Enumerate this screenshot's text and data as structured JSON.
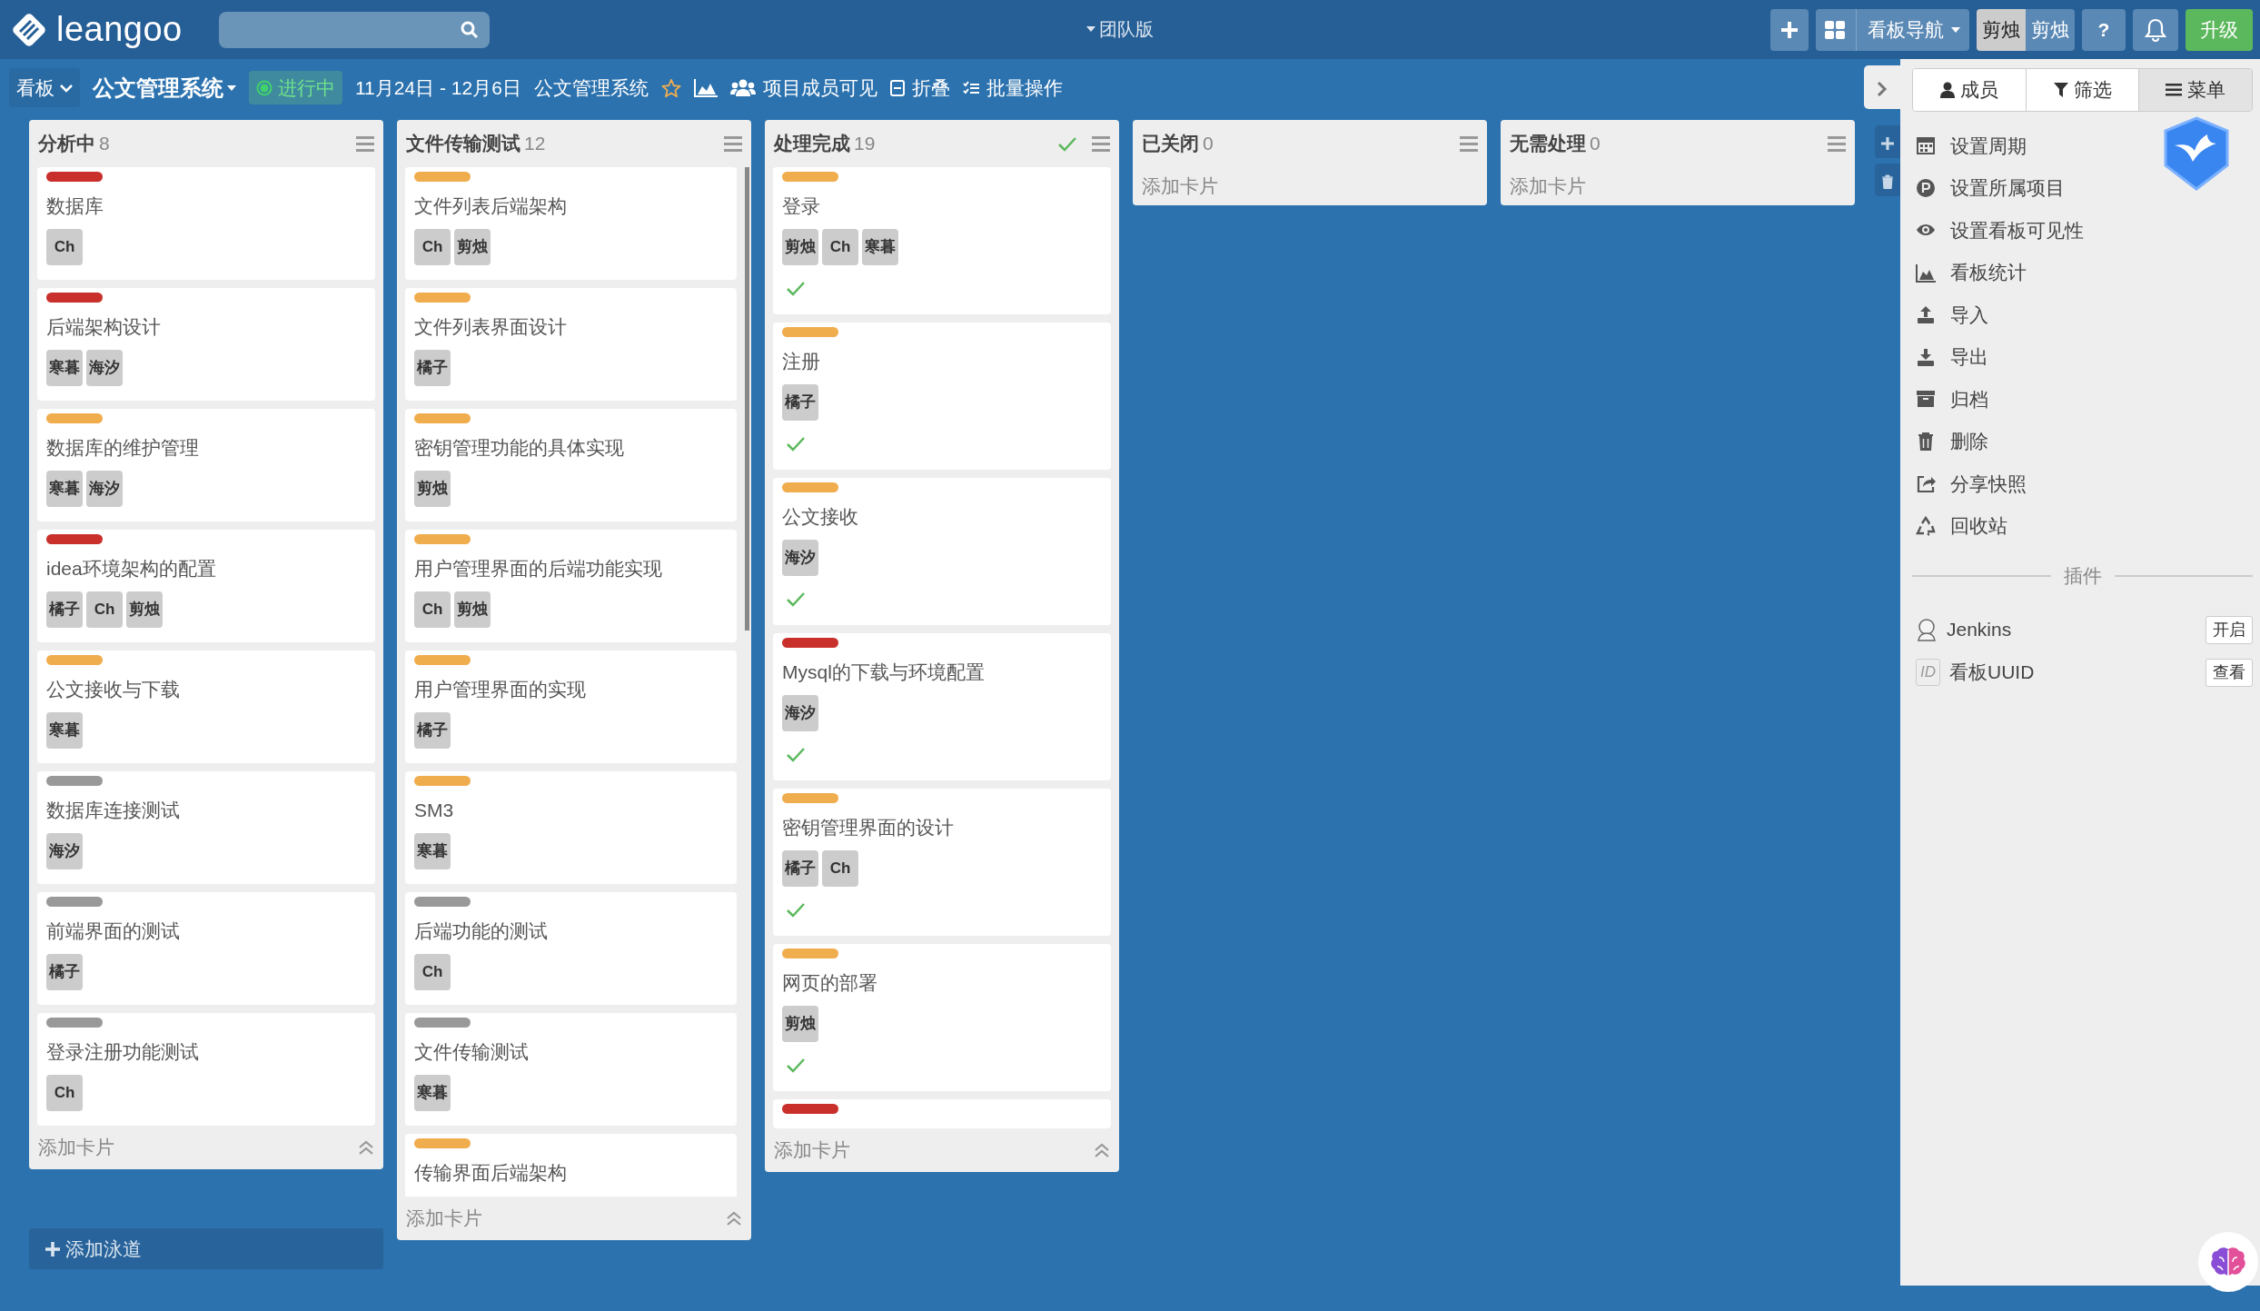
{
  "topbar": {
    "logo": "leangoo",
    "edition": "团队版",
    "nav": "看板导航",
    "user": {
      "avatar": "剪烛",
      "name": "剪烛"
    },
    "help": "?",
    "upgrade": "升级"
  },
  "board_bar": {
    "view": "看板",
    "title": "公文管理系统",
    "status": "进行中",
    "dates": "11月24日 - 12月6日",
    "project": "公文管理系统",
    "starred": false,
    "visibility": "项目成员可见",
    "collapse": "折叠",
    "batch": "批量操作"
  },
  "lists": [
    {
      "title": "分析中",
      "count": "8",
      "done": false,
      "add_card": "添加卡片",
      "cards": [
        {
          "color": "#c9302c",
          "title": "数据库",
          "members": [
            "Ch"
          ],
          "done": false
        },
        {
          "color": "#c9302c",
          "title": "后端架构设计",
          "members": [
            "寒暮",
            "海汐"
          ],
          "done": false
        },
        {
          "color": "#f0ad4e",
          "title": "数据库的维护管理",
          "members": [
            "寒暮",
            "海汐"
          ],
          "done": false
        },
        {
          "color": "#c9302c",
          "title": "idea环境架构的配置",
          "members": [
            "橘子",
            "Ch",
            "剪烛"
          ],
          "done": false
        },
        {
          "color": "#f0ad4e",
          "title": "公文接收与下载",
          "members": [
            "寒暮"
          ],
          "done": false
        },
        {
          "color": "#999999",
          "title": "数据库连接测试",
          "members": [
            "海汐"
          ],
          "done": false
        },
        {
          "color": "#999999",
          "title": "前端界面的测试",
          "members": [
            "橘子"
          ],
          "done": false
        },
        {
          "color": "#999999",
          "title": "登录注册功能测试",
          "members": [
            "Ch"
          ],
          "done": false
        }
      ]
    },
    {
      "title": "文件传输测试",
      "count": "12",
      "done": false,
      "add_card": "添加卡片",
      "cards": [
        {
          "color": "#f0ad4e",
          "title": "文件列表后端架构",
          "members": [
            "Ch",
            "剪烛"
          ],
          "done": false
        },
        {
          "color": "#f0ad4e",
          "title": "文件列表界面设计",
          "members": [
            "橘子"
          ],
          "done": false
        },
        {
          "color": "#f0ad4e",
          "title": "密钥管理功能的具体实现",
          "members": [
            "剪烛"
          ],
          "done": false
        },
        {
          "color": "#f0ad4e",
          "title": "用户管理界面的后端功能实现",
          "members": [
            "Ch",
            "剪烛"
          ],
          "done": false
        },
        {
          "color": "#f0ad4e",
          "title": "用户管理界面的实现",
          "members": [
            "橘子"
          ],
          "done": false
        },
        {
          "color": "#f0ad4e",
          "title": "SM3",
          "members": [
            "寒暮"
          ],
          "done": false
        },
        {
          "color": "#999999",
          "title": "后端功能的测试",
          "members": [
            "Ch"
          ],
          "done": false
        },
        {
          "color": "#999999",
          "title": "文件传输测试",
          "members": [
            "寒暮"
          ],
          "done": false
        },
        {
          "color": "#f0ad4e",
          "title": "传输界面后端架构",
          "done": false
        }
      ]
    },
    {
      "title": "处理完成",
      "count": "19",
      "done": true,
      "add_card": "添加卡片",
      "cards": [
        {
          "color": "#f0ad4e",
          "title": "登录",
          "members": [
            "剪烛",
            "Ch",
            "寒暮"
          ],
          "done": true
        },
        {
          "color": "#f0ad4e",
          "title": "注册",
          "members": [
            "橘子"
          ],
          "done": true
        },
        {
          "color": "#f0ad4e",
          "title": "公文接收",
          "members": [
            "海汐"
          ],
          "done": true
        },
        {
          "color": "#c9302c",
          "title": "Mysql的下载与环境配置",
          "members": [
            "海汐"
          ],
          "done": true
        },
        {
          "color": "#f0ad4e",
          "title": "密钥管理界面的设计",
          "members": [
            "橘子",
            "Ch"
          ],
          "done": true
        },
        {
          "color": "#f0ad4e",
          "title": "网页的部署",
          "members": [
            "剪烛"
          ],
          "done": true
        },
        {
          "color": "#c9302c",
          "done": false
        }
      ]
    },
    {
      "title": "已关闭",
      "count": "0",
      "done": false,
      "add_card": "添加卡片"
    },
    {
      "title": "无需处理",
      "count": "0",
      "done": false,
      "add_card": "添加卡片"
    }
  ],
  "add_lane": "添加泳道",
  "panel": {
    "tabs": [
      {
        "label": "成员",
        "selected": false
      },
      {
        "label": "筛选",
        "selected": false
      },
      {
        "label": "菜单",
        "selected": true
      }
    ],
    "menu": [
      "设置周期",
      "设置所属项目",
      "设置看板可见性",
      "看板统计",
      "导入",
      "导出",
      "归档",
      "删除",
      "分享快照",
      "回收站"
    ],
    "plugins_heading": "插件",
    "plugins": [
      {
        "name": "Jenkins",
        "action": "开启"
      },
      {
        "name": "看板UUID",
        "action": "查看",
        "badge": "ID"
      }
    ]
  }
}
